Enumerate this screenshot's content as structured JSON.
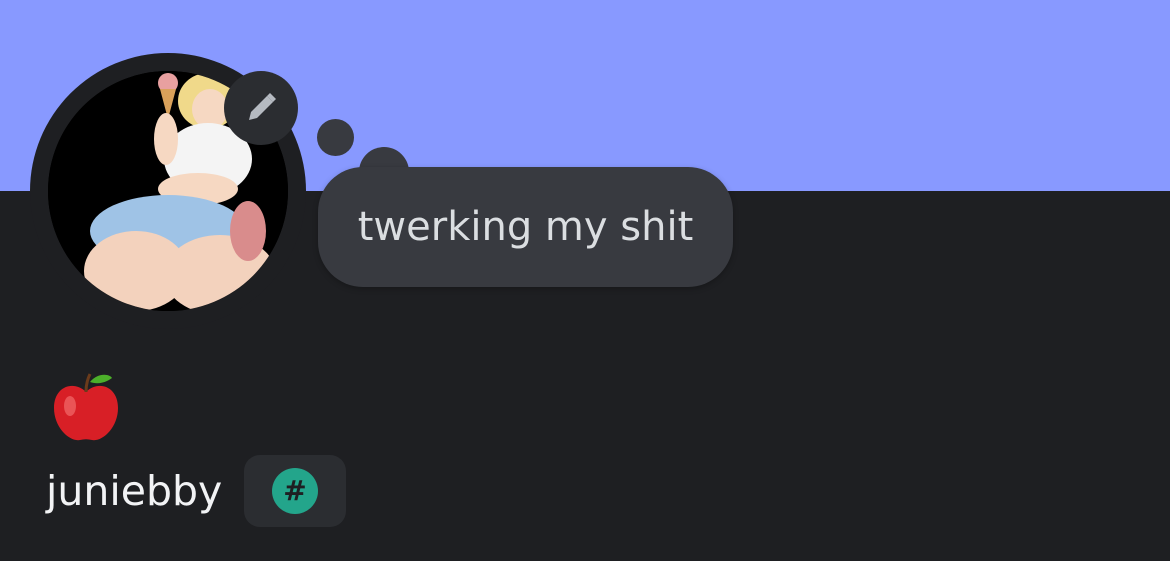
{
  "colors": {
    "banner": "#8899ff",
    "background": "#1e1f22",
    "bubble": "#383a40",
    "status_text": "#dbdee1",
    "username_text": "#f2f3f5",
    "badge_bg": "#2b2d31",
    "badge_accent": "#23a58b"
  },
  "profile": {
    "avatar_icon": "anime-character-avatar",
    "edit_icon": "pencil-icon",
    "custom_status": "twerking my shit",
    "status_emoji": "🍎",
    "username": "juniebby",
    "badge_icon": "hashtag-icon",
    "badge_symbol": "#"
  }
}
